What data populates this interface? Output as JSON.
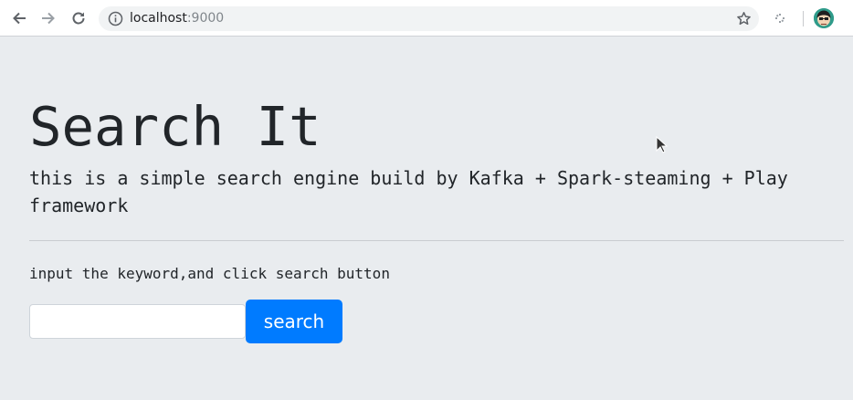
{
  "browser": {
    "url_host": "localhost",
    "url_port": ":9000",
    "icons": {
      "back": "arrow-left-icon",
      "forward": "arrow-right-icon",
      "reload": "reload-icon",
      "info": "info-icon",
      "bookmark": "star-icon",
      "extension": "extension-icon",
      "profile": "avatar"
    }
  },
  "page": {
    "title": "Search It",
    "lead": "this is a simple search engine build by Kafka + Spark-steaming + Play framework",
    "instruction": "input the keyword,and click search button",
    "search": {
      "value": "",
      "placeholder": "",
      "button_label": "search"
    }
  },
  "colors": {
    "background": "#e9ecef",
    "primary_button": "#007bff",
    "text": "#212529"
  }
}
